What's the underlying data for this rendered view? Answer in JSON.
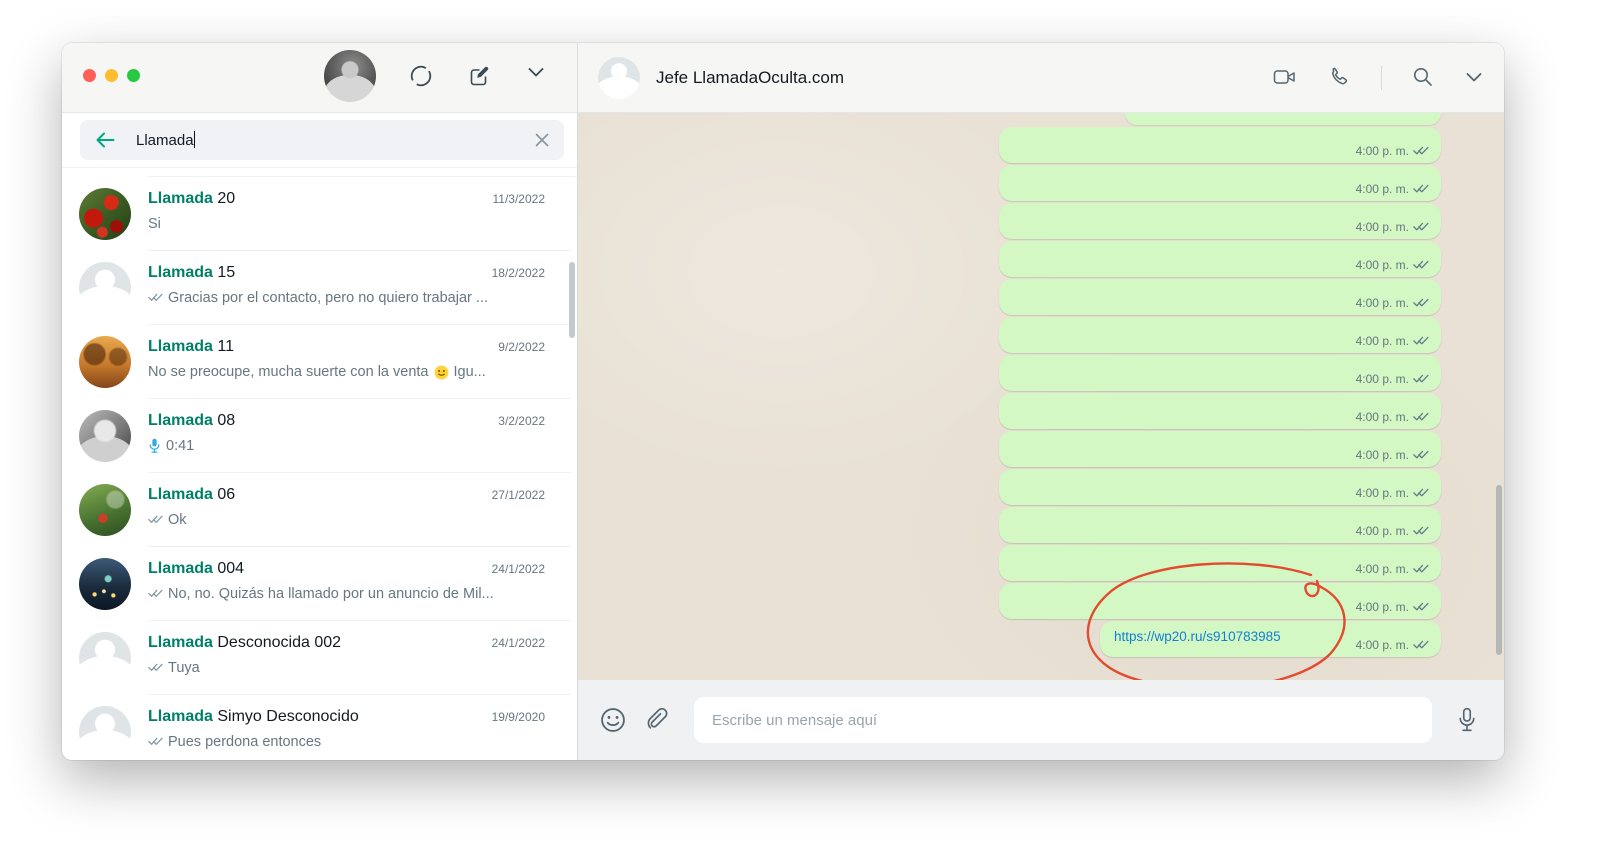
{
  "sidebar": {
    "search": {
      "value": "Llamada"
    },
    "chats": [
      {
        "avatar": "poppies",
        "name_highlight": "Llamada",
        "name_rest": "20",
        "date": "11/3/2022",
        "preview": {
          "check": false,
          "mic": null,
          "text": "Si",
          "smiley": false,
          "text_after": ""
        }
      },
      {
        "avatar": "default",
        "name_highlight": "Llamada",
        "name_rest": "15",
        "date": "18/2/2022",
        "preview": {
          "check": true,
          "mic": null,
          "text": "Gracias por el contacto, pero no quiero trabajar ...",
          "smiley": false,
          "text_after": ""
        }
      },
      {
        "avatar": "sepia",
        "name_highlight": "Llamada",
        "name_rest": "11",
        "date": "9/2/2022",
        "preview": {
          "check": false,
          "mic": null,
          "text": "No se preocupe, mucha suerte con la venta",
          "smiley": true,
          "text_after": "Igu..."
        }
      },
      {
        "avatar": "bw",
        "name_highlight": "Llamada",
        "name_rest": "08",
        "date": "3/2/2022",
        "preview": {
          "check": false,
          "mic": "0:41",
          "text": "",
          "smiley": false,
          "text_after": ""
        }
      },
      {
        "avatar": "green",
        "name_highlight": "Llamada",
        "name_rest": "06",
        "date": "27/1/2022",
        "preview": {
          "check": true,
          "mic": null,
          "text": "Ok",
          "smiley": false,
          "text_after": ""
        }
      },
      {
        "avatar": "city",
        "name_highlight": "Llamada",
        "name_rest": "004",
        "date": "24/1/2022",
        "preview": {
          "check": true,
          "mic": null,
          "text": "No, no. Quizás ha llamado por un anuncio de Mil...",
          "smiley": false,
          "text_after": ""
        }
      },
      {
        "avatar": "default",
        "name_highlight": "Llamada",
        "name_rest": "Desconocida 002",
        "date": "24/1/2022",
        "preview": {
          "check": true,
          "mic": null,
          "text": "Tuya",
          "smiley": false,
          "text_after": ""
        }
      },
      {
        "avatar": "default",
        "name_highlight": "Llamada",
        "name_rest": "Simyo Desconocido",
        "date": "19/9/2020",
        "preview": {
          "check": true,
          "mic": null,
          "text": "Pues perdona entonces",
          "smiley": false,
          "text_after": ""
        }
      }
    ]
  },
  "chat": {
    "title": "Jefe LlamadaOculta.com",
    "messages": [
      {
        "kind": "partial"
      },
      {
        "kind": "empty",
        "time": "4:00 p. m."
      },
      {
        "kind": "empty",
        "time": "4:00 p. m."
      },
      {
        "kind": "empty",
        "time": "4:00 p. m."
      },
      {
        "kind": "empty",
        "time": "4:00 p. m."
      },
      {
        "kind": "empty",
        "time": "4:00 p. m."
      },
      {
        "kind": "empty",
        "time": "4:00 p. m."
      },
      {
        "kind": "empty",
        "time": "4:00 p. m."
      },
      {
        "kind": "empty",
        "time": "4:00 p. m."
      },
      {
        "kind": "empty",
        "time": "4:00 p. m."
      },
      {
        "kind": "empty",
        "time": "4:00 p. m."
      },
      {
        "kind": "empty",
        "time": "4:00 p. m."
      },
      {
        "kind": "empty",
        "time": "4:00 p. m."
      },
      {
        "kind": "empty",
        "time": "4:00 p. m."
      },
      {
        "kind": "link",
        "link_text": "https://wp20.ru/s910783985",
        "time": "4:00 p. m."
      }
    ],
    "composer": {
      "placeholder": "Escribe un mensaje aquí"
    }
  },
  "icons": {
    "toolbar": [
      "status-icon",
      "new-chat-icon",
      "chevron-down-icon"
    ],
    "header": [
      "video-call-icon",
      "voice-call-icon",
      "search-icon",
      "chevron-down-icon"
    ],
    "composer": [
      "emoji-icon",
      "attach-icon",
      "mic-icon"
    ]
  },
  "colors": {
    "accent": "#008069",
    "arrow": "#00a884",
    "bubble": "#d4f8c4",
    "chat-bg": "#e9e1d5",
    "link": "#127fd2",
    "annotation": "#e24b2f",
    "meta": "#667781",
    "mic-blue": "#35a9e0"
  }
}
